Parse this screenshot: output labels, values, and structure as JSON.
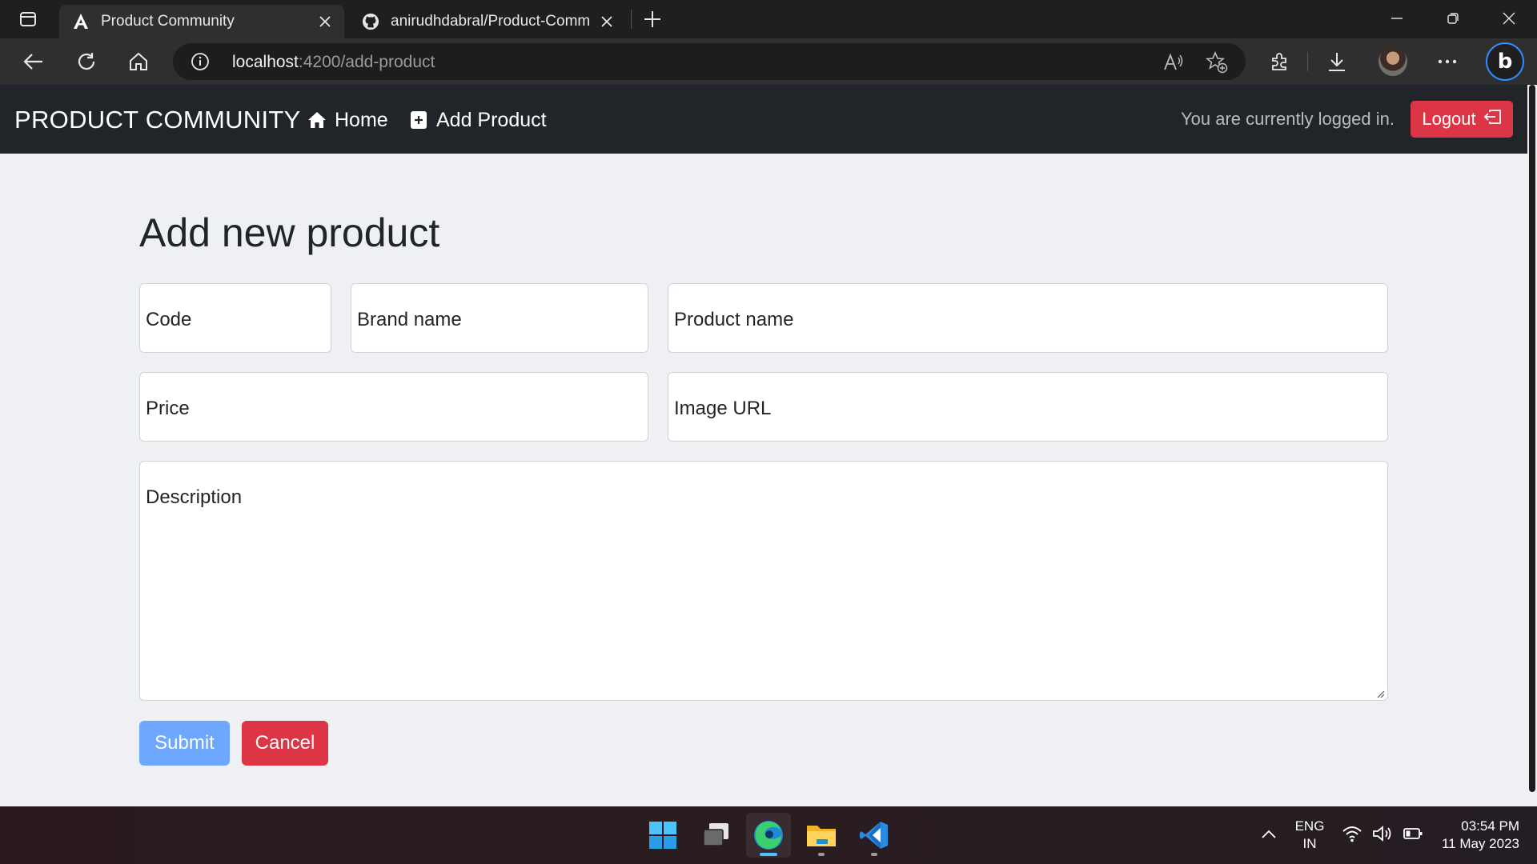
{
  "browser": {
    "tabs": [
      {
        "title": "Product Community",
        "active": true
      },
      {
        "title": "anirudhdabral/Product-Community",
        "active": false
      }
    ],
    "url": {
      "host": "localhost",
      "rest": ":4200/add-product"
    }
  },
  "navbar": {
    "brand": "PRODUCT COMMUNITY",
    "links": [
      {
        "label": "Home",
        "icon": "house-icon"
      },
      {
        "label": "Add Product",
        "icon": "plus-square-icon"
      }
    ],
    "status_text": "You are currently logged in.",
    "logout_label": "Logout"
  },
  "form": {
    "title": "Add new product",
    "fields": {
      "code": {
        "placeholder": "Code",
        "value": ""
      },
      "brand": {
        "placeholder": "Brand name",
        "value": ""
      },
      "product_name": {
        "placeholder": "Product name",
        "value": ""
      },
      "price": {
        "placeholder": "Price",
        "value": ""
      },
      "image_url": {
        "placeholder": "Image URL",
        "value": ""
      },
      "description": {
        "placeholder": "Description",
        "value": ""
      }
    },
    "submit_label": "Submit",
    "cancel_label": "Cancel"
  },
  "taskbar": {
    "apps": [
      "windows-start-icon",
      "task-view-icon",
      "edge-icon",
      "file-explorer-icon",
      "vscode-icon"
    ],
    "lang_line1": "ENG",
    "lang_line2": "IN",
    "time": "03:54 PM",
    "date": "11 May 2023"
  },
  "colors": {
    "navbar_bg": "#212529",
    "page_bg": "#eff0f4",
    "danger": "#dc3545",
    "primary_light": "#6ea8fe"
  }
}
